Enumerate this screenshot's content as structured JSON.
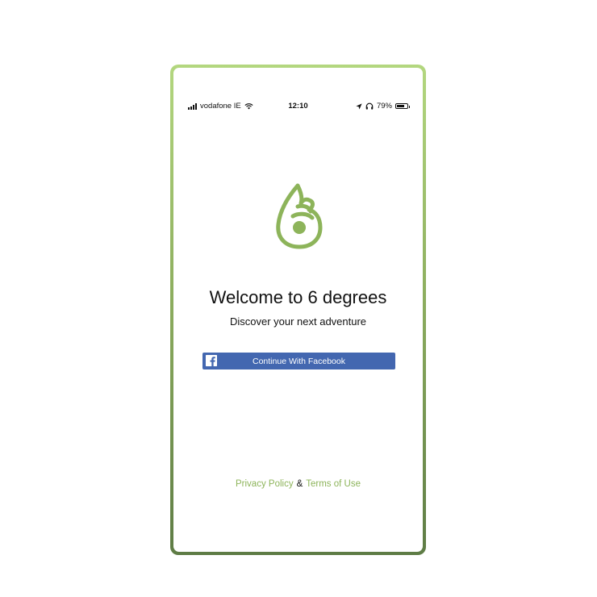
{
  "status_bar": {
    "carrier": "vodafone IE",
    "time": "12:10",
    "battery": "79%",
    "battery_level": 0.79
  },
  "welcome": {
    "title": "Welcome to 6 degrees",
    "tagline": "Discover your next adventure"
  },
  "facebook_button": {
    "label": "Continue With Facebook"
  },
  "footer": {
    "privacy_label": "Privacy Policy",
    "separator": "&",
    "terms_label": "Terms of Use"
  },
  "colors": {
    "brand_green": "#8db45a",
    "facebook_blue": "#4367b0"
  },
  "icons": [
    "signal-icon",
    "wifi-icon",
    "location-icon",
    "headphones-icon",
    "battery-icon",
    "hand-logo-icon",
    "facebook-icon"
  ]
}
